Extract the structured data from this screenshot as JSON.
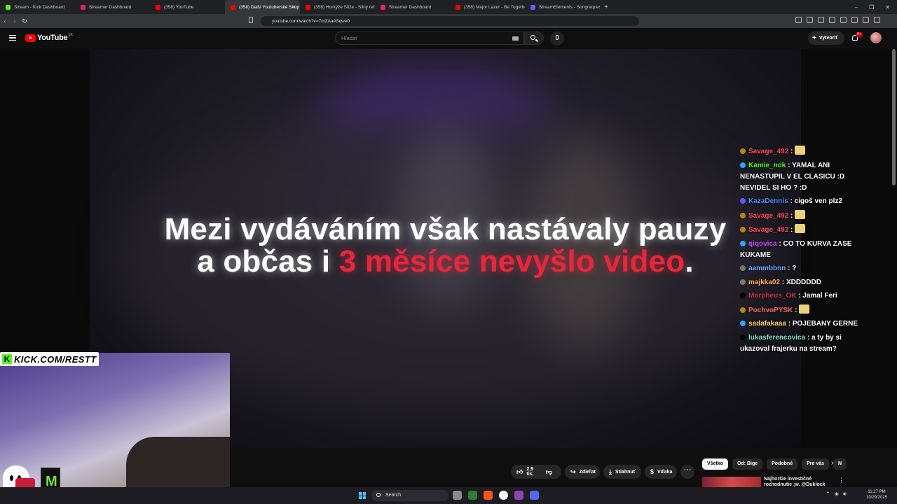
{
  "browser": {
    "tabs": [
      {
        "label": "Stream - Kick Dashboard",
        "color": "#53fc18",
        "active": false
      },
      {
        "label": "Streamer Dashboard",
        "color": "#e91e63",
        "active": false
      },
      {
        "label": "(358) YouTube",
        "color": "#ff0000",
        "active": false
      },
      {
        "label": "(358) Další Youtuberské Skup",
        "color": "#ff0000",
        "active": true
      },
      {
        "label": "(358) Horkýže Slíže - Silný refrén [ofi",
        "color": "#ff0000",
        "active": false
      },
      {
        "label": "Streamer Dashboard",
        "color": "#e91e63",
        "active": false
      },
      {
        "label": "(358) Major Lazer - Be Together (feat",
        "color": "#ff0000",
        "active": false
      },
      {
        "label": "StreamElements - Songrequest",
        "color": "#6a5cff",
        "active": false
      }
    ],
    "new_tab": "+",
    "url": "youtube.com/watch?v=7mZAaA5qwe0",
    "window_controls": [
      "–",
      "❐",
      "✕"
    ]
  },
  "youtube": {
    "logo_text": "YouTube",
    "country": "SK",
    "search_placeholder": "Hľadať",
    "create_label": "Vytvoriť",
    "notifications_badge": "9+"
  },
  "video": {
    "caption_line1": "Mezi vydáváním však nastávaly pauzy",
    "caption_line2_white": "a občas i ",
    "caption_line2_red": "3 měsíce nevyšlo video",
    "caption_line2_end": "."
  },
  "stream_overlay": {
    "kick_text": "KICK.COM/RESTT",
    "chat": [
      {
        "user": "Savage_492",
        "text": "",
        "user_color": "#ff4d5e",
        "emote": true,
        "icon": "#b8860b"
      },
      {
        "user": "Kamie_nok",
        "text": "YAMAL ANI NENASTUPIL V EL CLASICU :D NEVIDEL SI HO ? :D",
        "user_color": "#53fc18",
        "icon": "#2aa8ff"
      },
      {
        "user": "KazaDennis",
        "text": "cigoš ven plz2",
        "user_color": "#4f8dff",
        "icon": "#5b5bff"
      },
      {
        "user": "Savage_492",
        "text": "",
        "user_color": "#ff4d5e",
        "emote": true,
        "icon": "#b8860b"
      },
      {
        "user": "Savage_492",
        "text": "",
        "user_color": "#ff4d5e",
        "emote": true,
        "icon": "#b8860b"
      },
      {
        "user": "qiqovica",
        "text": "CO TO KURVA ZASE KUKAME",
        "user_color": "#c850ff",
        "icon": "#2aa8ff"
      },
      {
        "user": "aammbbnn",
        "text": "?",
        "user_color": "#6ab0ff",
        "icon": "#777"
      },
      {
        "user": "majkka02",
        "text": "XDDDDDD",
        "user_color": "#ffb347",
        "icon": "#777"
      },
      {
        "user": "Morpheus_OK",
        "text": "Jamal Feri",
        "user_color": "#d0344a",
        "icon": "#000"
      },
      {
        "user": "PochvoPYSK",
        "text": "",
        "user_color": "#ff6f61",
        "emote": true,
        "icon": "#b8860b"
      },
      {
        "user": "sadafakaaa",
        "text": "POJEBANY GERNE",
        "user_color": "#ffd866",
        "icon": "#2aa8ff"
      },
      {
        "user": "lukasferencovica",
        "text": "a ty by si ukazoval frajerku na stream?",
        "user_color": "#7de3c2",
        "icon": "#000"
      }
    ]
  },
  "actions": {
    "likes": "2,9 tis.",
    "share": "Zdieľať",
    "download": "Stiahnuť",
    "thanks": "Vďaka",
    "more": "···"
  },
  "recommendations": {
    "chips": [
      "Všetko",
      "Od: Bige",
      "Podobné",
      "Pre vás",
      "N"
    ],
    "first_title": "Najhoršie investičné rozhodnutie ;w. @Duklock"
  },
  "taskbar": {
    "search_label": "Search",
    "time": "11:27 PM",
    "date": "10/29/2025"
  }
}
